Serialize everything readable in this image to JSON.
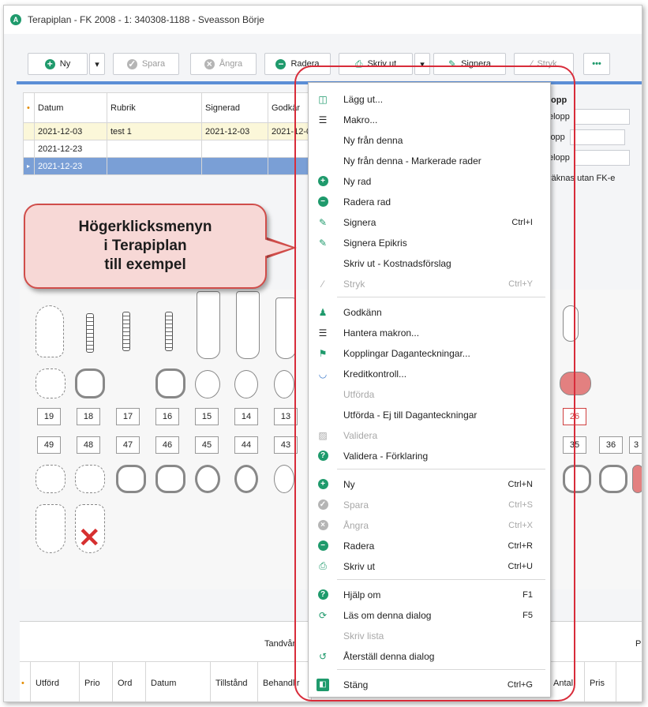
{
  "window": {
    "title": "Terapiplan - FK 2008 - 1: 340308-1188 - Sveasson Börje",
    "app_icon_letter": "A"
  },
  "toolbar": {
    "ny": "Ny",
    "spara": "Spara",
    "angra": "Ångra",
    "radera": "Radera",
    "skriv_ut": "Skriv ut",
    "signera": "Signera",
    "stryk": "Stryk",
    "more": "•••"
  },
  "grid": {
    "headers": [
      "Datum",
      "Rubrik",
      "Signerad",
      "Godkär"
    ],
    "rows": [
      [
        "2021-12-03",
        "test 1",
        "2021-12-03",
        "2021-12-0"
      ],
      [
        "2021-12-23",
        "",
        "",
        ""
      ],
      [
        "2021-12-23",
        "",
        "",
        ""
      ]
    ]
  },
  "right_panel": {
    "header": "lopp",
    "rows": [
      "elopp",
      "lopp",
      "elopp"
    ],
    "note": "räknas utan FK-e"
  },
  "callout": {
    "line1": "Högerklicksmenyn",
    "line2": "i Terapiplan",
    "line3": "till exempel"
  },
  "teeth": {
    "upper_numbers": [
      "19",
      "18",
      "17",
      "16",
      "15",
      "14",
      "13"
    ],
    "lower_numbers": [
      "49",
      "48",
      "47",
      "46",
      "45",
      "44",
      "43"
    ],
    "right_upper_number": "26",
    "right_lower_numbers": [
      "35",
      "36",
      "3"
    ]
  },
  "bottom": {
    "header_center": "Tandvår",
    "header_right": "P",
    "columns": [
      "Utförd",
      "Prio",
      "Ord",
      "Datum",
      "Tillstånd",
      "Behandlir",
      "Antal",
      "Pris"
    ]
  },
  "context_menu": {
    "items": [
      {
        "label": "Lägg ut...",
        "shortcut": "",
        "icon": "layout-icon",
        "disabled": false
      },
      {
        "label": "Makro...",
        "shortcut": "",
        "icon": "macro-icon",
        "disabled": false
      },
      {
        "label": "Ny från denna",
        "shortcut": "",
        "icon": "",
        "disabled": false
      },
      {
        "label": "Ny från denna - Markerade rader",
        "shortcut": "",
        "icon": "",
        "disabled": false
      },
      {
        "label": "Ny rad",
        "shortcut": "",
        "icon": "plus-icon",
        "disabled": false
      },
      {
        "label": "Radera rad",
        "shortcut": "",
        "icon": "minus-icon",
        "disabled": false
      },
      {
        "label": "Signera",
        "shortcut": "Ctrl+I",
        "icon": "pen-icon",
        "disabled": false
      },
      {
        "label": "Signera Epikris",
        "shortcut": "",
        "icon": "pen-icon",
        "disabled": false
      },
      {
        "label": "Skriv ut - Kostnadsförslag",
        "shortcut": "",
        "icon": "",
        "disabled": false
      },
      {
        "label": "Stryk",
        "shortcut": "Ctrl+Y",
        "icon": "strike-icon",
        "disabled": true
      },
      {
        "label": "Godkänn",
        "shortcut": "",
        "icon": "approve-icon",
        "disabled": false
      },
      {
        "label": "Hantera makron...",
        "shortcut": "",
        "icon": "macro-icon",
        "disabled": false
      },
      {
        "label": "Kopplingar Daganteckningar...",
        "shortcut": "",
        "icon": "link-icon",
        "disabled": false
      },
      {
        "label": "Kreditkontroll...",
        "shortcut": "",
        "icon": "credit-icon",
        "disabled": false
      },
      {
        "label": "Utförda",
        "shortcut": "",
        "icon": "",
        "disabled": true
      },
      {
        "label": "Utförda - Ej till Daganteckningar",
        "shortcut": "",
        "icon": "",
        "disabled": false
      },
      {
        "label": "Validera",
        "shortcut": "",
        "icon": "validate-icon",
        "disabled": true
      },
      {
        "label": "Validera - Förklaring",
        "shortcut": "",
        "icon": "help-icon",
        "disabled": false
      },
      {
        "label": "Ny",
        "shortcut": "Ctrl+N",
        "icon": "plus-icon",
        "disabled": false
      },
      {
        "label": "Spara",
        "shortcut": "Ctrl+S",
        "icon": "save-icon",
        "disabled": true
      },
      {
        "label": "Ångra",
        "shortcut": "Ctrl+X",
        "icon": "undo-icon",
        "disabled": true
      },
      {
        "label": "Radera",
        "shortcut": "Ctrl+R",
        "icon": "minus-icon",
        "disabled": false
      },
      {
        "label": "Skriv ut",
        "shortcut": "Ctrl+U",
        "icon": "printer-icon",
        "disabled": false
      },
      {
        "label": "Hjälp om",
        "shortcut": "F1",
        "icon": "help-icon",
        "disabled": false
      },
      {
        "label": "Läs om denna dialog",
        "shortcut": "F5",
        "icon": "reload-icon",
        "disabled": false
      },
      {
        "label": "Skriv lista",
        "shortcut": "",
        "icon": "",
        "disabled": true
      },
      {
        "label": "Återställ denna dialog",
        "shortcut": "",
        "icon": "reset-icon",
        "disabled": false
      },
      {
        "label": "Stäng",
        "shortcut": "Ctrl+G",
        "icon": "close-window-icon",
        "disabled": false
      }
    ]
  },
  "colors": {
    "accent": "#1f9a6c",
    "highlight_frame": "#d82c3a",
    "selection": "#7a9fd6",
    "callout_fill": "#f7d8d6"
  }
}
